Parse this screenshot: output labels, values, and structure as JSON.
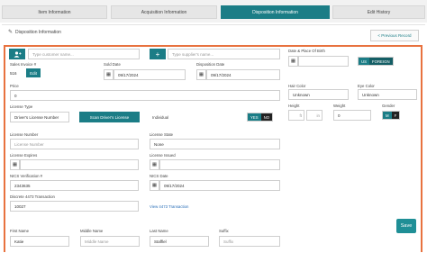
{
  "tabs": [
    {
      "label": "Item Information"
    },
    {
      "label": "Acquisition Information"
    },
    {
      "label": "Disposition Information"
    },
    {
      "label": "Edit History"
    }
  ],
  "section": {
    "title": "Disposition Information",
    "previous_label": "< Previous Record"
  },
  "customer": {
    "placeholder": "Type customer name..."
  },
  "supplier": {
    "placeholder": "Type supplier's name..."
  },
  "sales_invoice": {
    "label": "Sales Invoice #",
    "value": "516",
    "edit_label": "Edit"
  },
  "sold_date": {
    "label": "Sold Date",
    "value": "09/17/2024"
  },
  "disposition_date": {
    "label": "Disposition Date",
    "value": "09/17/2024"
  },
  "price": {
    "label": "Price",
    "value": "0"
  },
  "license_type": {
    "label": "License Type",
    "value": "Driver's License Number",
    "scan_label": "Scan Driver's License"
  },
  "individual": {
    "label": "Individual",
    "yes": "YES",
    "no": "NO"
  },
  "license_number": {
    "label": "License Number",
    "placeholder": "License Number"
  },
  "license_state": {
    "label": "License State",
    "value": "None"
  },
  "license_expires": {
    "label": "License Expires"
  },
  "license_issued": {
    "label": "License Issued"
  },
  "nics": {
    "label": "NICS Verification #",
    "value": "2343635"
  },
  "nics_date": {
    "label": "NICS Date",
    "value": "09/17/2024"
  },
  "atf": {
    "label": "Discrete 4473 Transaction",
    "value": "10027",
    "link": "View 4473 Transaction"
  },
  "dob": {
    "label": "Date & Place Of Birth",
    "us": "US",
    "foreign": "FOREIGN"
  },
  "hair": {
    "label": "Hair Color",
    "value": "Unknown"
  },
  "eye": {
    "label": "Eye Color",
    "value": "Unknown"
  },
  "height": {
    "label": "Height",
    "ft": "ft",
    "in": "in"
  },
  "weight": {
    "label": "Weight",
    "value": "0"
  },
  "gender": {
    "label": "Gender",
    "m": "M",
    "f": "F"
  },
  "names": {
    "first_label": "First Name",
    "first_value": "Katie",
    "middle_label": "Middle Name",
    "middle_placeholder": "Middle Name",
    "last_label": "Last Name",
    "last_value": "Stafflel",
    "suffix_label": "Suffix",
    "suffix_placeholder": "Suffix"
  },
  "save_label": "Save",
  "colors": {
    "accent": "#1b7d86",
    "frame": "#e8723f"
  }
}
